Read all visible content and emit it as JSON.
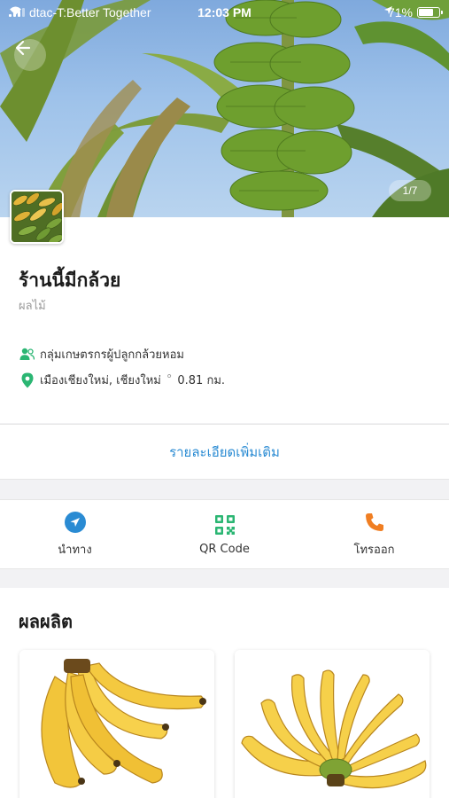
{
  "status_bar": {
    "carrier": "dtac-T:Better Together",
    "time": "12:03 PM",
    "battery": "71%",
    "battery_level": 0.71
  },
  "hero": {
    "page_indicator": "1/7"
  },
  "shop": {
    "name": "ร้านนี้มีกล้วย",
    "category": "ผลไม้",
    "group": "กลุ่มเกษตรกรผู้ปลูกกล้วยหอม",
    "location": "เมืองเชียงใหม่, เชียงใหม่",
    "distance": "0.81 กม.",
    "more_details": "รายละเอียดเพิ่มเติม"
  },
  "actions": [
    {
      "label": "นำทาง",
      "icon": "navigate-icon",
      "color": "#2a8bd3"
    },
    {
      "label": "QR Code",
      "icon": "qr-code-icon",
      "color": "#2bb673"
    },
    {
      "label": "โทรออก",
      "icon": "phone-icon",
      "color": "#f07e22"
    }
  ],
  "products": {
    "title": "ผลผลิต"
  },
  "colors": {
    "accent_blue": "#2a8bd3",
    "accent_green": "#2bb673",
    "accent_orange": "#f07e22"
  }
}
